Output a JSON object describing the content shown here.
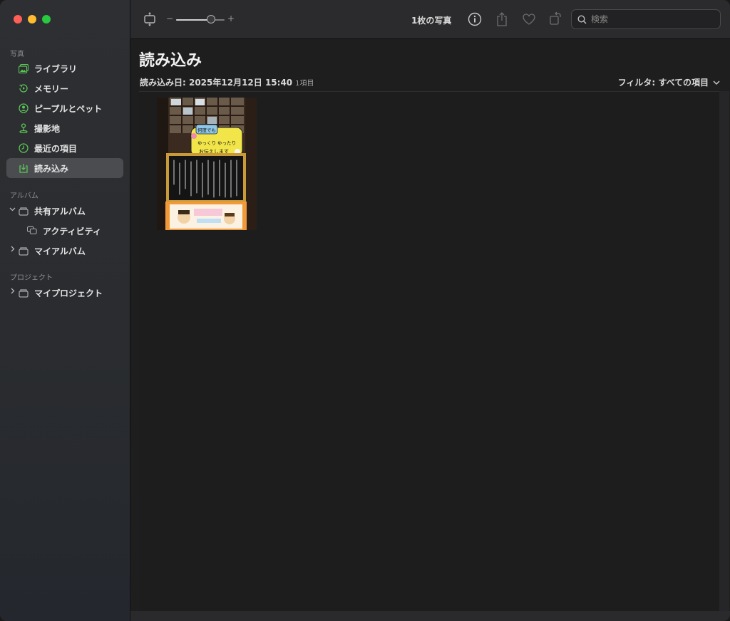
{
  "sidebar": {
    "photos_section": "写真",
    "items": [
      {
        "label": "ライブラリ",
        "icon": "photo-library-icon"
      },
      {
        "label": "メモリー",
        "icon": "memories-icon"
      },
      {
        "label": "ピープルとペット",
        "icon": "person-icon"
      },
      {
        "label": "撮影地",
        "icon": "map-pin-icon"
      },
      {
        "label": "最近の項目",
        "icon": "clock-icon"
      },
      {
        "label": "読み込み",
        "icon": "import-icon"
      }
    ],
    "albums_section": "アルバム",
    "albums": [
      {
        "label": "共有アルバム",
        "icon": "shared-album-icon"
      },
      {
        "label": "アクティビティ",
        "icon": "activity-icon"
      },
      {
        "label": "マイアルバム",
        "icon": "album-folder-icon"
      }
    ],
    "projects_section": "プロジェクト",
    "projects": [
      {
        "label": "マイプロジェクト",
        "icon": "project-folder-icon"
      }
    ]
  },
  "toolbar": {
    "zoom_minus": "−",
    "zoom_plus": "+",
    "zoom_level": 0.72,
    "photo_count": "1枚の写真",
    "search_placeholder": "検索"
  },
  "content": {
    "title": "読み込み",
    "import_date_label": "読み込み日: 2025年12月12日 15:40",
    "import_count": "1項目",
    "filter_label": "フィルタ: すべての項目"
  },
  "photo_sign": {
    "bubble_line1": "何度でも",
    "bubble_line2": "ゆっくり ゆったり",
    "bubble_line3": "お伝えします"
  },
  "colors": {
    "accent_green": "#5cc456",
    "selected_bg": "#4a4c50"
  }
}
